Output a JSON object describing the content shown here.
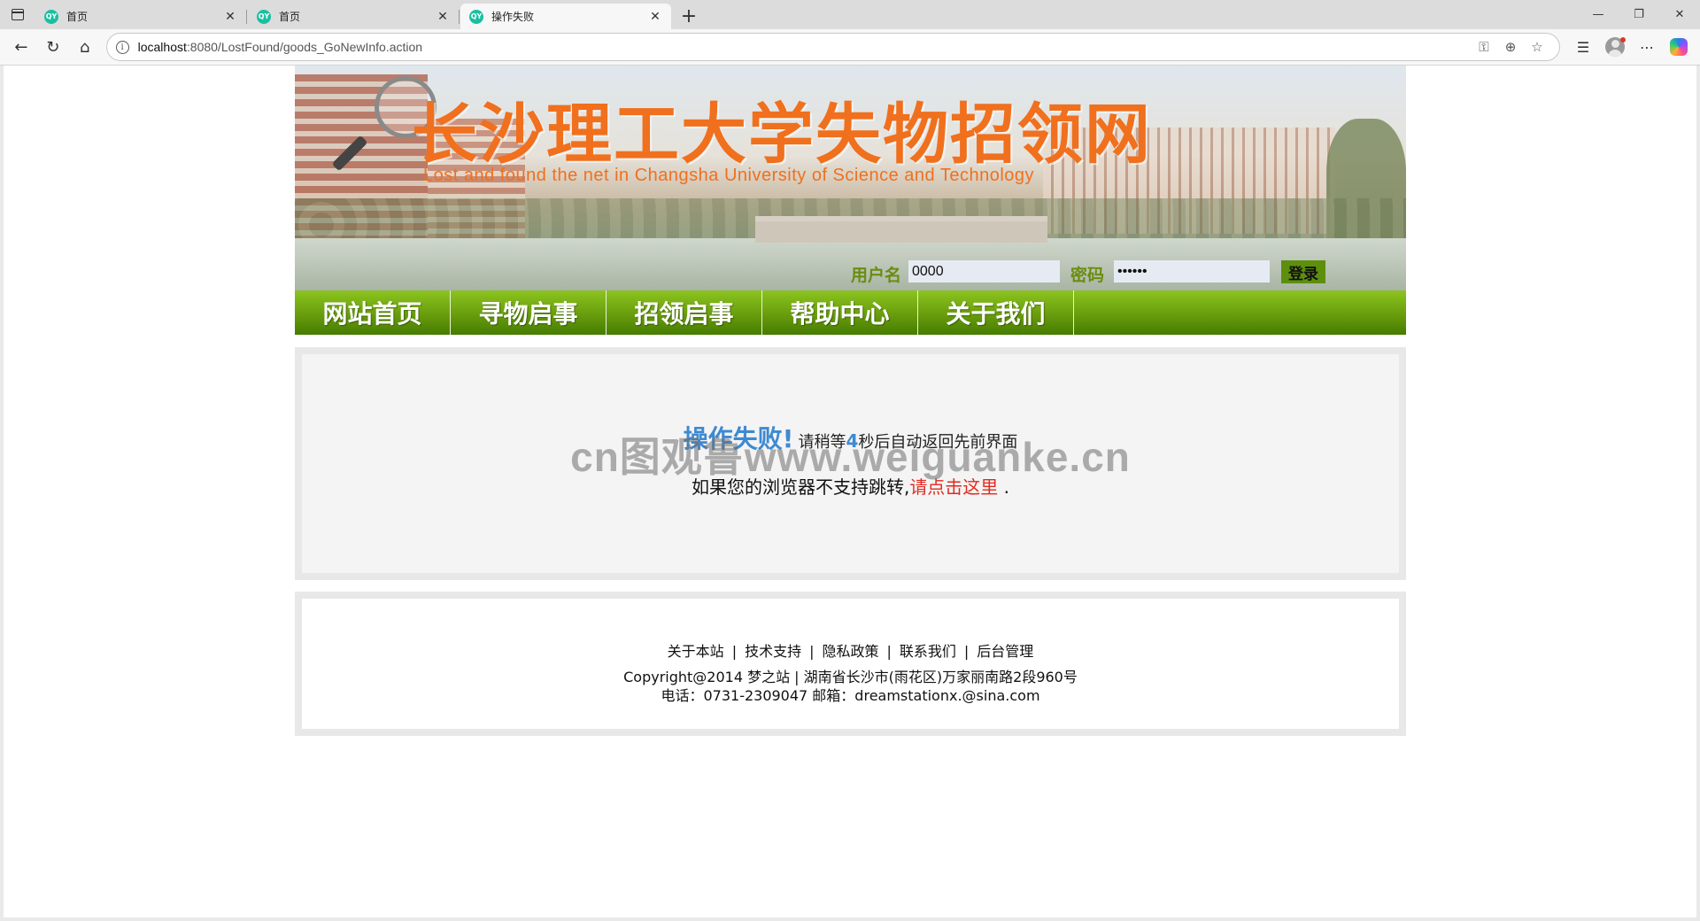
{
  "browser": {
    "tabs": [
      {
        "title": "首页",
        "favicon": "QY",
        "active": false
      },
      {
        "title": "首页",
        "favicon": "QY",
        "active": false
      },
      {
        "title": "操作失败",
        "favicon": "QY",
        "active": true
      }
    ],
    "url_host": "localhost",
    "url_rest": ":8080/LostFound/goods_GoNewInfo.action"
  },
  "banner": {
    "title": "长沙理工大学失物招领网",
    "subtitle": "Lost and found the net in Changsha University of Science and Technology"
  },
  "login": {
    "username_label": "用户名",
    "username_value": "0000",
    "password_label": "密码",
    "password_value": "••••••",
    "submit_label": "登录"
  },
  "nav": {
    "items": [
      {
        "label": "网站首页"
      },
      {
        "label": "寻物启事"
      },
      {
        "label": "招领启事"
      },
      {
        "label": "帮助中心"
      },
      {
        "label": "关于我们"
      }
    ]
  },
  "message": {
    "title": "操作失败!",
    "countdown_prefix": "请稍等",
    "countdown_seconds": "4",
    "countdown_suffix": "秒后自动返回先前界面",
    "fallback_text": "如果您的浏览器不支持跳转,",
    "fallback_link": "请点击这里",
    "fallback_end": " ."
  },
  "watermark": "cn图观鲁www.weiguanke.cn",
  "footer": {
    "links": [
      "关于本站",
      "技术支持",
      "隐私政策",
      "联系我们",
      "后台管理"
    ],
    "separator": "|",
    "copyright": "Copyright@2014 梦之站 | 湖南省长沙市(雨花区)万家丽南路2段960号",
    "contact": "电话：0731-2309047 邮箱：dreamstationx.@sina.com"
  }
}
